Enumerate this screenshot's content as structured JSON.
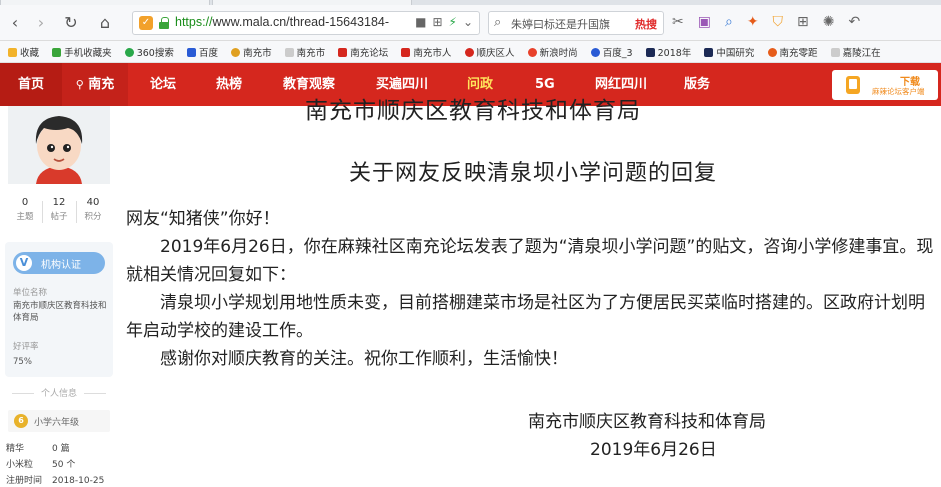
{
  "browser": {
    "url_scheme": "https://",
    "url_rest": "www.mala.cn/thread-15643184-",
    "search_text": "朱婷曰标还是升国旗",
    "search_hot": "热搜",
    "bookmarks": [
      "收藏",
      "手机收藏夹",
      "360搜索",
      "百度",
      "南充市",
      "南充市",
      "南充论坛",
      "南充市人",
      "顺庆区人",
      "新浪时尚",
      "百度_3",
      "2018年",
      "中国研究",
      "南充零距",
      "嘉陵江在"
    ]
  },
  "sitenav": {
    "home": "首页",
    "city": "南充",
    "items": [
      "论坛",
      "热榜",
      "教育观察",
      "买遍四川",
      "问政",
      "5G",
      "网红四川",
      "版务"
    ],
    "download_title": "下载",
    "download_sub": "麻辣论坛客户端"
  },
  "sidebar": {
    "stats": [
      {
        "num": "0",
        "label": "主题"
      },
      {
        "num": "12",
        "label": "帖子"
      },
      {
        "num": "40",
        "label": "积分"
      }
    ],
    "cert_label": "机构认证",
    "org_name_key": "单位名称",
    "org_name_value": "南充市顺庆区教育科技和体育局",
    "rating_key": "好评率",
    "rating_value": "75%",
    "personal_title": "个人信息",
    "grade": "小学六年级",
    "info": [
      {
        "key": "精华",
        "value": "0 篇"
      },
      {
        "key": "小米粒",
        "value": "50 个"
      },
      {
        "key": "注册时间",
        "value": "2018-10-25"
      }
    ]
  },
  "letter": {
    "org_title": "南充市顺庆区教育科技和体育局",
    "subject": "关于网友反映清泉坝小学问题的回复",
    "greeting": "网友“知猪侠”你好！",
    "para1": "　　2019年6月26日，你在麻辣社区南充论坛发表了题为“清泉坝小学问题”的贴文，咨询小学修建事宜。现就相关情况回复如下：",
    "para2": "　　清泉坝小学规划用地性质未变，目前搭棚建菜市场是社区为了方便居民买菜临时搭建的。区政府计划明年启动学校的建设工作。",
    "para3": "　　感谢你对顺庆教育的关注。祝你工作顺利，生活愉快！",
    "signature": "南充市顺庆区教育科技和体育局",
    "date": "2019年6月26日"
  },
  "colors": {
    "nav_red": "#d5271e",
    "active_yellow": "#ffe45c",
    "cert_blue": "#7db3e8"
  }
}
